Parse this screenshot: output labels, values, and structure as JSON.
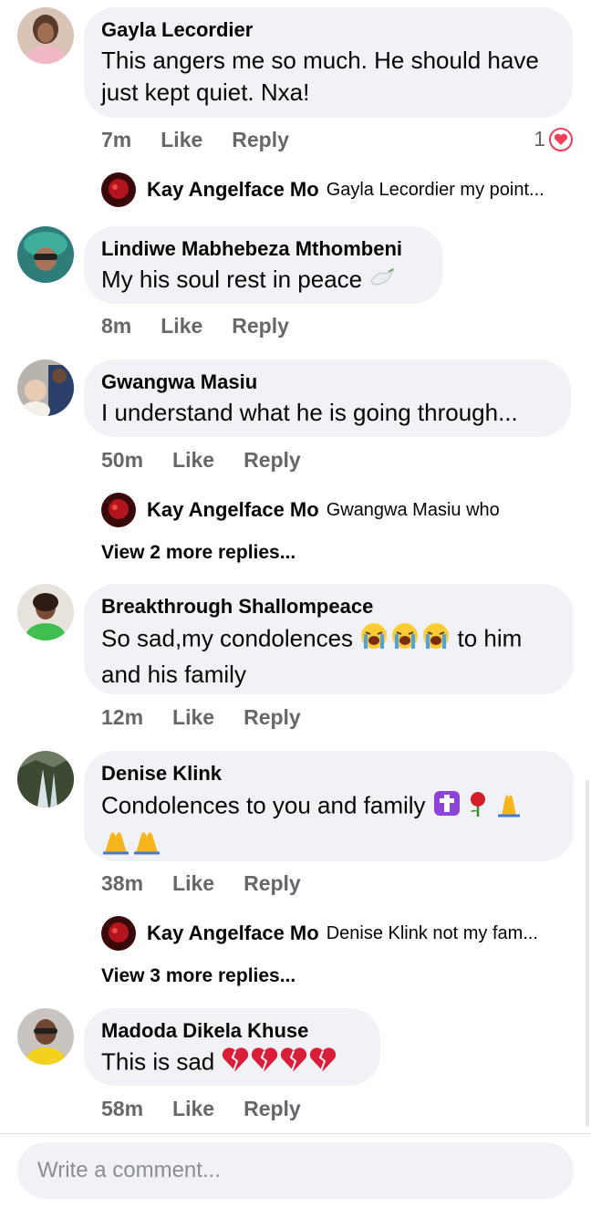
{
  "colors": {
    "bubble": "#f0f2f5",
    "meta": "#65676b",
    "heart": "#f33e58"
  },
  "comments": [
    {
      "author": "Gayla Lecordier",
      "text": "This angers me so much. He should have just kept quiet. Nxa!",
      "time": "7m",
      "like": "Like",
      "reply": "Reply",
      "reactions": "1",
      "replies": [
        {
          "author": "Kay Angelface Mo",
          "text": "Gayla Lecordier my point..."
        }
      ]
    },
    {
      "author": "Lindiwe Mabhebeza Mthombeni",
      "text": "My his soul rest in peace",
      "emoji": "dove-emoji",
      "time": "8m",
      "like": "Like",
      "reply": "Reply"
    },
    {
      "author": "Gwangwa Masiu",
      "text": "I understand what he is going through...",
      "time": "50m",
      "like": "Like",
      "reply": "Reply",
      "replies": [
        {
          "author": "Kay Angelface Mo",
          "text": "Gwangwa Masiu who"
        }
      ],
      "view_more": "View 2 more replies..."
    },
    {
      "author": "Breakthrough Shallompeace",
      "text_before": "So sad,my condolences",
      "text_after": "to him and his family",
      "emoji": "loudly-crying-face-emoji",
      "time": "12m",
      "like": "Like",
      "reply": "Reply"
    },
    {
      "author": "Denise Klink",
      "text": "Condolences to you and family",
      "emoji": "cross-rose-praying-hands-emoji",
      "time": "38m",
      "like": "Like",
      "reply": "Reply",
      "replies": [
        {
          "author": "Kay Angelface Mo",
          "text": "Denise Klink  not my fam..."
        }
      ],
      "view_more": "View 3 more replies..."
    },
    {
      "author": "Madoda Dikela Khuse",
      "text": "This is sad",
      "emoji": "broken-heart-emoji",
      "time": "58m",
      "like": "Like",
      "reply": "Reply"
    }
  ],
  "composer": {
    "placeholder": "Write a comment..."
  }
}
